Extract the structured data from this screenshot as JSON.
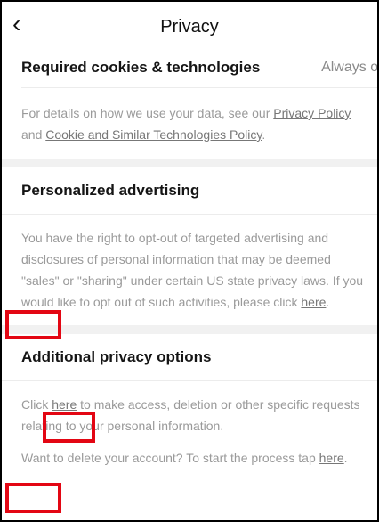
{
  "header": {
    "back_icon": "‹",
    "title": "Privacy"
  },
  "required": {
    "title": "Required cookies & technologies",
    "status": "Always on",
    "details_prefix": "For details on how we use your data, see our ",
    "privacy_policy_link": "Privacy Policy",
    "details_middle": " and ",
    "cookie_policy_link": "Cookie and Similar Technologies Policy",
    "details_suffix": "."
  },
  "personalized": {
    "title": "Personalized advertising",
    "text": "You have the right to opt-out of targeted advertising and disclosures of personal information that may be deemed \"sales\" or \"sharing\" under certain US state privacy laws. If you would like to opt out of such activities, please click ",
    "link": "here",
    "suffix": "."
  },
  "additional": {
    "title": "Additional privacy options",
    "access_prefix": "Click ",
    "access_link": "here",
    "access_suffix": " to make access, deletion or other specific requests relating to your personal information.",
    "delete_prefix": "Want to delete your account? To start the process tap ",
    "delete_link": "here",
    "delete_suffix": "."
  }
}
